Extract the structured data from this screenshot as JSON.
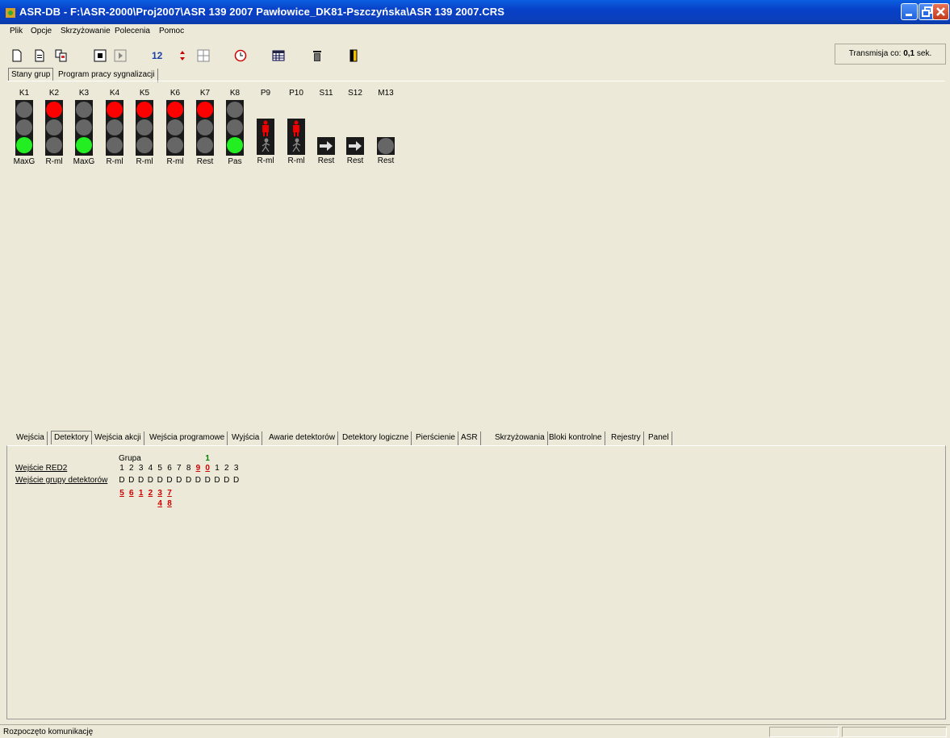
{
  "window": {
    "title": "ASR-DB - F:\\ASR-2000\\Proj2007\\ASR 139 2007 Pawłowice_DK81-Pszczyńska\\ASR 139 2007.CRS"
  },
  "menu": {
    "items": [
      "Plik",
      "Opcje",
      "Skrzyżowanie",
      "Polecenia",
      "Pomoc"
    ]
  },
  "toolbar": {
    "counter_text": "12",
    "transmission_label": "Transmisja co:",
    "transmission_value": "0,1",
    "transmission_unit": "sek."
  },
  "upper_tabs": [
    "Stany grup",
    "Program pracy sygnalizacji"
  ],
  "signal_groups": [
    {
      "label": "K1",
      "type": "vehicle",
      "lamps": [
        "off",
        "off",
        "green"
      ],
      "state": "MaxG"
    },
    {
      "label": "K2",
      "type": "vehicle",
      "lamps": [
        "red",
        "off",
        "off"
      ],
      "state": "R-ml"
    },
    {
      "label": "K3",
      "type": "vehicle",
      "lamps": [
        "off",
        "off",
        "green"
      ],
      "state": "MaxG"
    },
    {
      "label": "K4",
      "type": "vehicle",
      "lamps": [
        "red",
        "off",
        "off"
      ],
      "state": "R-ml"
    },
    {
      "label": "K5",
      "type": "vehicle",
      "lamps": [
        "red",
        "off",
        "off"
      ],
      "state": "R-ml"
    },
    {
      "label": "K6",
      "type": "vehicle",
      "lamps": [
        "red",
        "off",
        "off"
      ],
      "state": "R-ml"
    },
    {
      "label": "K7",
      "type": "vehicle",
      "lamps": [
        "red",
        "off",
        "off"
      ],
      "state": "Rest"
    },
    {
      "label": "K8",
      "type": "vehicle",
      "lamps": [
        "off",
        "off",
        "green"
      ],
      "state": "Pas"
    },
    {
      "label": "P9",
      "type": "pedestrian",
      "state": "R-ml"
    },
    {
      "label": "P10",
      "type": "pedestrian",
      "state": "R-ml"
    },
    {
      "label": "S11",
      "type": "arrow",
      "state": "Rest"
    },
    {
      "label": "S12",
      "type": "arrow",
      "state": "Rest"
    },
    {
      "label": "M13",
      "type": "round",
      "state": "Rest"
    }
  ],
  "lower_tabs": [
    "Wejścia",
    "Detektory",
    "Wejścia akcji",
    "Wejścia programowe",
    "Wyjścia",
    "Awarie detektorów",
    "Detektory logiczne",
    "Pierścienie",
    "ASR",
    "Skrzyżowania",
    "Bloki kontrolne",
    "Rejestry",
    "Panel"
  ],
  "detectors": {
    "group_header": "Grupa",
    "rows": [
      "Wejście RED2",
      "Wejście grupy detektorów"
    ],
    "tens_row": [
      "",
      "",
      "",
      "",
      "",
      "",
      "",
      "",
      "",
      "1",
      "",
      "",
      ""
    ],
    "group_numbers": [
      "1",
      "2",
      "3",
      "4",
      "5",
      "6",
      "7",
      "8",
      "9",
      "0",
      "1",
      "2",
      "3"
    ],
    "types": [
      "D",
      "D",
      "D",
      "D",
      "D",
      "D",
      "D",
      "D",
      "D",
      "D",
      "D",
      "D",
      "D"
    ],
    "detector_row1": [
      "5",
      "6",
      "1",
      "2",
      "3",
      "7"
    ],
    "detector_row2": [
      "4",
      "8"
    ]
  },
  "statusbar": {
    "text": "Rozpoczęto komunikację"
  },
  "colors": {
    "titlebar": "#0a49d0",
    "red_lamp": "#ff0000",
    "green_lamp": "#22ee22",
    "off_lamp": "#666666",
    "highlight_red": "#cc0000",
    "highlight_green": "#008000"
  }
}
